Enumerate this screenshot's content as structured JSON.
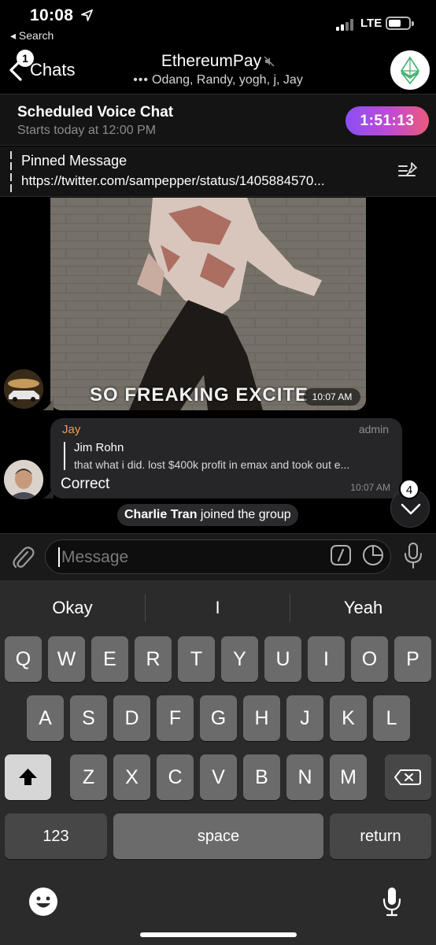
{
  "status_bar": {
    "time": "10:08",
    "back_app": "◂ Search",
    "network": "LTE",
    "icons": [
      "location-arrow-icon",
      "signal-icon",
      "battery-icon"
    ]
  },
  "header": {
    "back_label": "Chats",
    "unread_count": "1",
    "title": "EthereumPay",
    "typing_dots": "•••",
    "typing_members": "Odang, Randy, yogh, j, Jay",
    "icons": [
      "chevron-left-icon",
      "mute-icon",
      "group-avatar-ethereum"
    ]
  },
  "voice_chat": {
    "title": "Scheduled Voice Chat",
    "subtitle": "Starts today at 12:00 PM",
    "countdown": "1:51:13"
  },
  "pinned": {
    "title": "Pinned Message",
    "text": "https://twitter.com/sampepper/status/1405884570...",
    "icon": "pin-list-icon"
  },
  "messages": {
    "gif": {
      "caption": "SO FREAKING EXCITE",
      "time": "10:07 AM"
    },
    "reply": {
      "author": "Jay",
      "role": "admin",
      "quoted_author": "Jim Rohn",
      "quoted_text": "that what i did. lost $400k profit in emax and took out e...",
      "text": "Correct",
      "time": "10:07 AM"
    },
    "service": {
      "name": "Charlie Tran",
      "action": " joined the group"
    },
    "scroll_badge": "4"
  },
  "input": {
    "placeholder": "Message",
    "icons": [
      "paperclip-icon",
      "command-icon",
      "sticker-icon",
      "microphone-icon"
    ]
  },
  "keyboard": {
    "suggestions": [
      "Okay",
      "I",
      "Yeah"
    ],
    "row1": [
      "Q",
      "W",
      "E",
      "R",
      "T",
      "Y",
      "U",
      "I",
      "O",
      "P"
    ],
    "row2": [
      "A",
      "S",
      "D",
      "F",
      "G",
      "H",
      "J",
      "K",
      "L"
    ],
    "row3": [
      "Z",
      "X",
      "C",
      "V",
      "B",
      "N",
      "M"
    ],
    "numbers_key": "123",
    "space_key": "space",
    "return_key": "return"
  }
}
